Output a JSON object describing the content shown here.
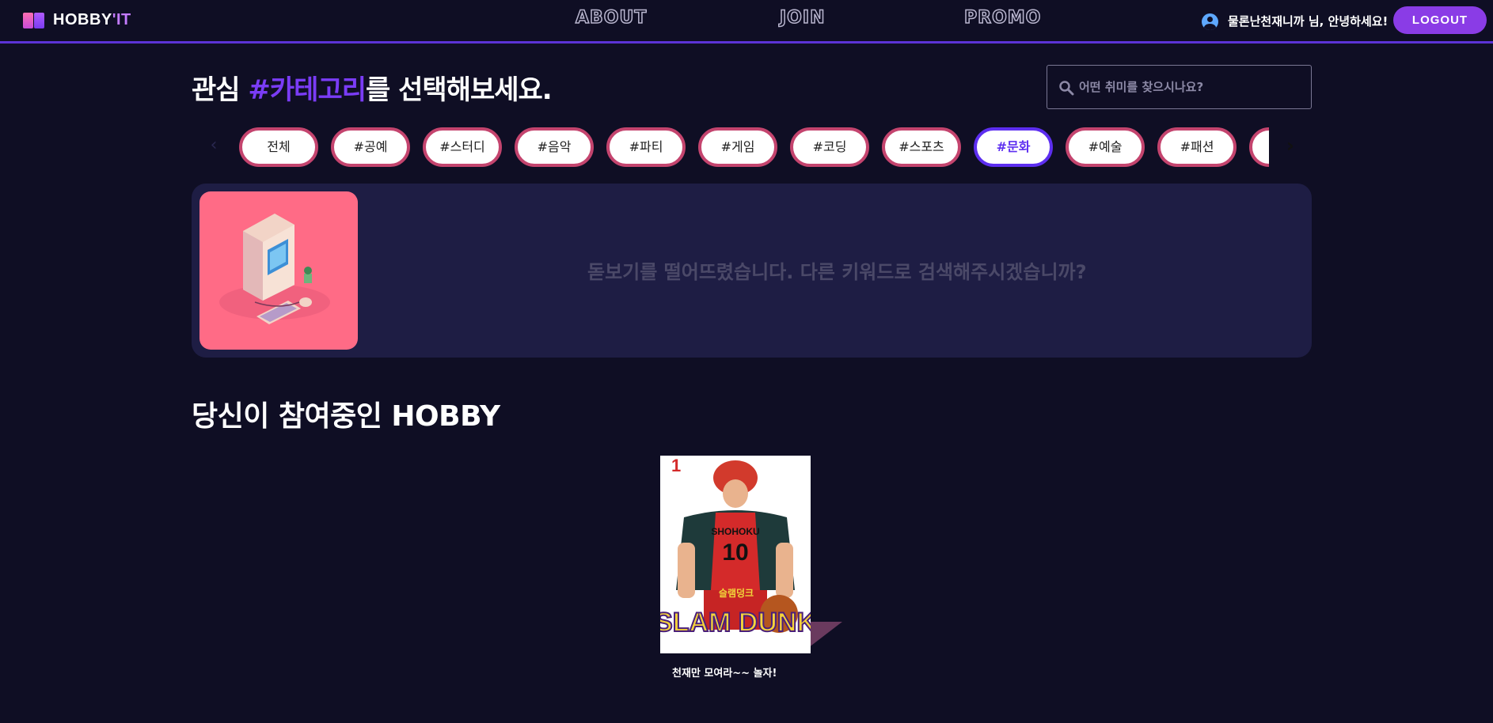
{
  "header": {
    "logo_text": "HOBBY",
    "logo_accent": "'IT",
    "nav": [
      "ABOUT",
      "JOIN",
      "PROMO"
    ],
    "greeting": "물론난천재니까 님, 안녕하세요!",
    "logout_label": "LOGOUT"
  },
  "title": {
    "prefix": "관심 ",
    "accent": "#카테고리",
    "suffix": "를 선택해보세요."
  },
  "search": {
    "placeholder": "어떤 취미를 찾으시나요?"
  },
  "categories": {
    "items": [
      "전체",
      "#공예",
      "#스터디",
      "#음악",
      "#파티",
      "#게임",
      "#코딩",
      "#스포츠",
      "#문화",
      "#예술",
      "#패션"
    ],
    "active": "#문화"
  },
  "banner": {
    "message": "돋보기를 떨어뜨렸습니다. 다른 키워드로 검색해주시겠습니까?"
  },
  "my_hobby": {
    "title": "당신이 참여중인 HOBBY",
    "cards": [
      {
        "title": "천재만 모여라~~ 놀자!",
        "cover_issue": "1",
        "cover_title": "SLAM DUNK",
        "cover_subtitle": "슬램덩크",
        "jersey_number": "10",
        "jersey_text": "SHOHOKU"
      }
    ]
  },
  "colors": {
    "background": "#0f0e24",
    "accent": "#7a3cf6",
    "chip_border": "#c4446e",
    "chip_active": "#5d2ef0",
    "logout": "#8a3ce6"
  },
  "icons": {
    "search": "search-icon",
    "user": "user-icon",
    "prev": "chevron-left-icon",
    "next": "chevron-right-icon"
  }
}
